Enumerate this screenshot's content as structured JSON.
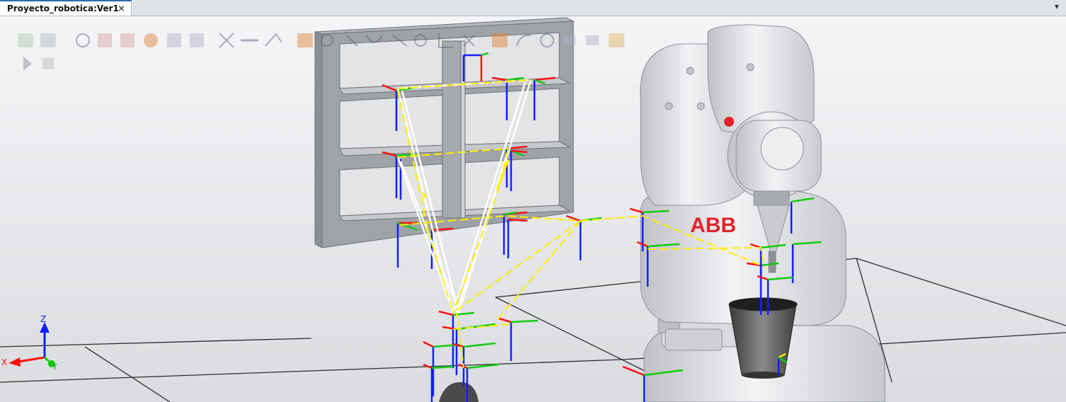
{
  "document_tab": {
    "title": "Proyecto_robotica:Ver1",
    "close_glyph": "×"
  },
  "tab_menu_glyph": "▾",
  "robot": {
    "brand": "ABB"
  },
  "axis_triad": {
    "x": "X",
    "y": "Y",
    "z": "Z"
  },
  "icons": {
    "row1": [
      "view-solid-icon",
      "view-box-icon",
      "snap-object-icon",
      "snap-center-icon",
      "snap-edge-icon",
      "snap-end-icon",
      "snap-mid-icon",
      "snap-grid-icon",
      "snap-frame-icon",
      "measure-point-icon",
      "measure-angle-icon",
      "measure-diameter-icon",
      "measure-distance-icon",
      "select-group-icon",
      "select-curve-icon",
      "select-surface-icon",
      "select-body-icon",
      "select-part-icon",
      "select-target-icon",
      "select-path-icon",
      "freehand-move-icon",
      "freehand-rotate-icon",
      "jog-linear-icon",
      "jog-reorient-icon",
      "multirobot-jog-icon",
      "window-icon",
      "layout-icon"
    ],
    "row2": [
      "play-icon",
      "stop-icon"
    ]
  },
  "colors": {
    "axis_x": "#ff1010",
    "axis_y": "#10cc10",
    "axis_z": "#1020ff",
    "path": "#ffee00",
    "brand_red": "#e2222a",
    "robot_body": "#e2e3e6"
  }
}
